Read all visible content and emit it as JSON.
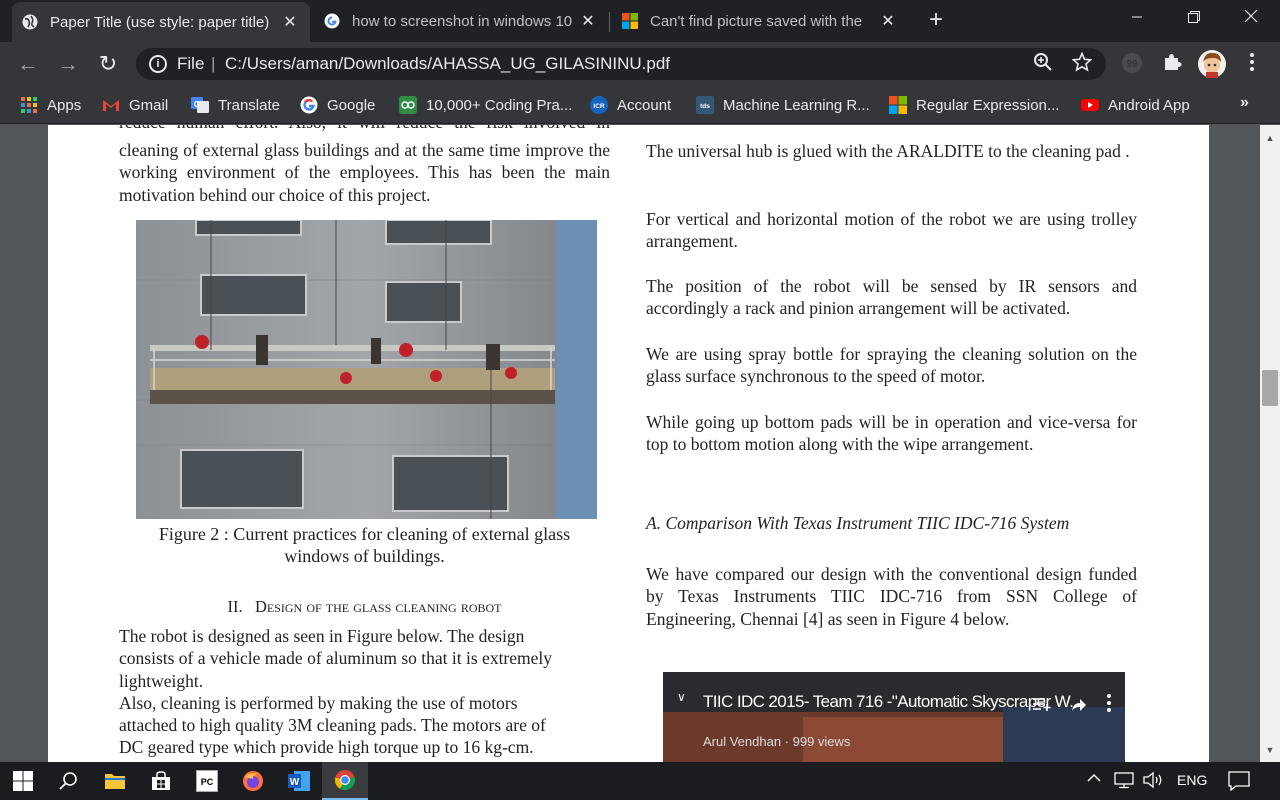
{
  "tabs": [
    {
      "title": "Paper Title (use style: paper title)",
      "close": "✕"
    },
    {
      "title": "how to screenshot in windows 10",
      "close": "✕"
    },
    {
      "title": "Can't find picture saved with the",
      "close": "✕"
    }
  ],
  "new_tab": "+",
  "window_controls": {
    "minimize": "—",
    "restore": "❐",
    "close": "✕"
  },
  "toolbar": {
    "back": "←",
    "forward": "→",
    "reload": "↻",
    "info_icon": "i",
    "scheme": "File",
    "separator": "|",
    "url": "C:/Users/aman/Downloads/AHASSA_UG_GILASININU.pdf"
  },
  "bookmarks": [
    {
      "label": "Apps",
      "icon": "apps-grid-icon"
    },
    {
      "label": "Gmail",
      "icon": "gmail-icon"
    },
    {
      "label": "Translate",
      "icon": "translate-icon"
    },
    {
      "label": "Google",
      "icon": "google-icon"
    },
    {
      "label": "10,000+ Coding Pra...",
      "icon": "coding-icon"
    },
    {
      "label": "Account",
      "icon": "icr-icon"
    },
    {
      "label": "Machine Learning R...",
      "icon": "tds-icon"
    },
    {
      "label": "Regular Expression...",
      "icon": "microsoft-icon"
    },
    {
      "label": "Android App",
      "icon": "youtube-icon"
    }
  ],
  "bookmarks_more": "»",
  "pdf": {
    "left": {
      "cut_line": "reduce human effort. Also, it will reduce the risk involved in",
      "para1": "cleaning of external glass buildings and at the same time improve the working environment of the employees. This has been the main motivation behind our choice of this project.",
      "fig_caption_1": "Figure 2 : Current practices for cleaning of external glass",
      "fig_caption_2": "windows of buildings.",
      "section_num": "II.",
      "section_title": "Design of the glass cleaning robot",
      "para2_l1": "The robot is designed as seen in Figure below. The design",
      "para2_l2": "consists of a vehicle made of aluminum so that it is extremely",
      "para2_l3": "lightweight.",
      "para3_l1": "Also, cleaning is performed by making the use of motors",
      "para3_l2": "attached to high quality 3M cleaning pads. The motors are of",
      "para3_l3": "DC geared type which provide high torque up to 16 kg-cm."
    },
    "right": {
      "p1": "The universal hub is glued with the ARALDITE to the cleaning pad .",
      "p2": "For vertical and horizontal motion of the robot we are using trolley arrangement.",
      "p3": "The position of the robot will be sensed by IR sensors and accordingly a rack and  pinion arrangement will be activated.",
      "p4": "We are using spray bottle for spraying the cleaning solution on the glass surface  synchronous to the speed of motor.",
      "p5": "While going up bottom pads will be in operation and vice-versa for top to bottom motion along with the wipe arrangement.",
      "subsection": "A.  Comparison With Texas Instrument TIIC IDC-716 System",
      "p6": "We have compared our design with the conventional design funded by Texas Instruments TIIC IDC-716 from SSN College of Engineering, Chennai [4] as seen in Figure 4 below."
    },
    "video": {
      "title": "TIIC IDC 2015- Team 716 -\"Automatic Skyscraper W...",
      "channel": "Arul Vendhan · 999 views"
    }
  },
  "taskbar": {
    "language": "ENG"
  }
}
